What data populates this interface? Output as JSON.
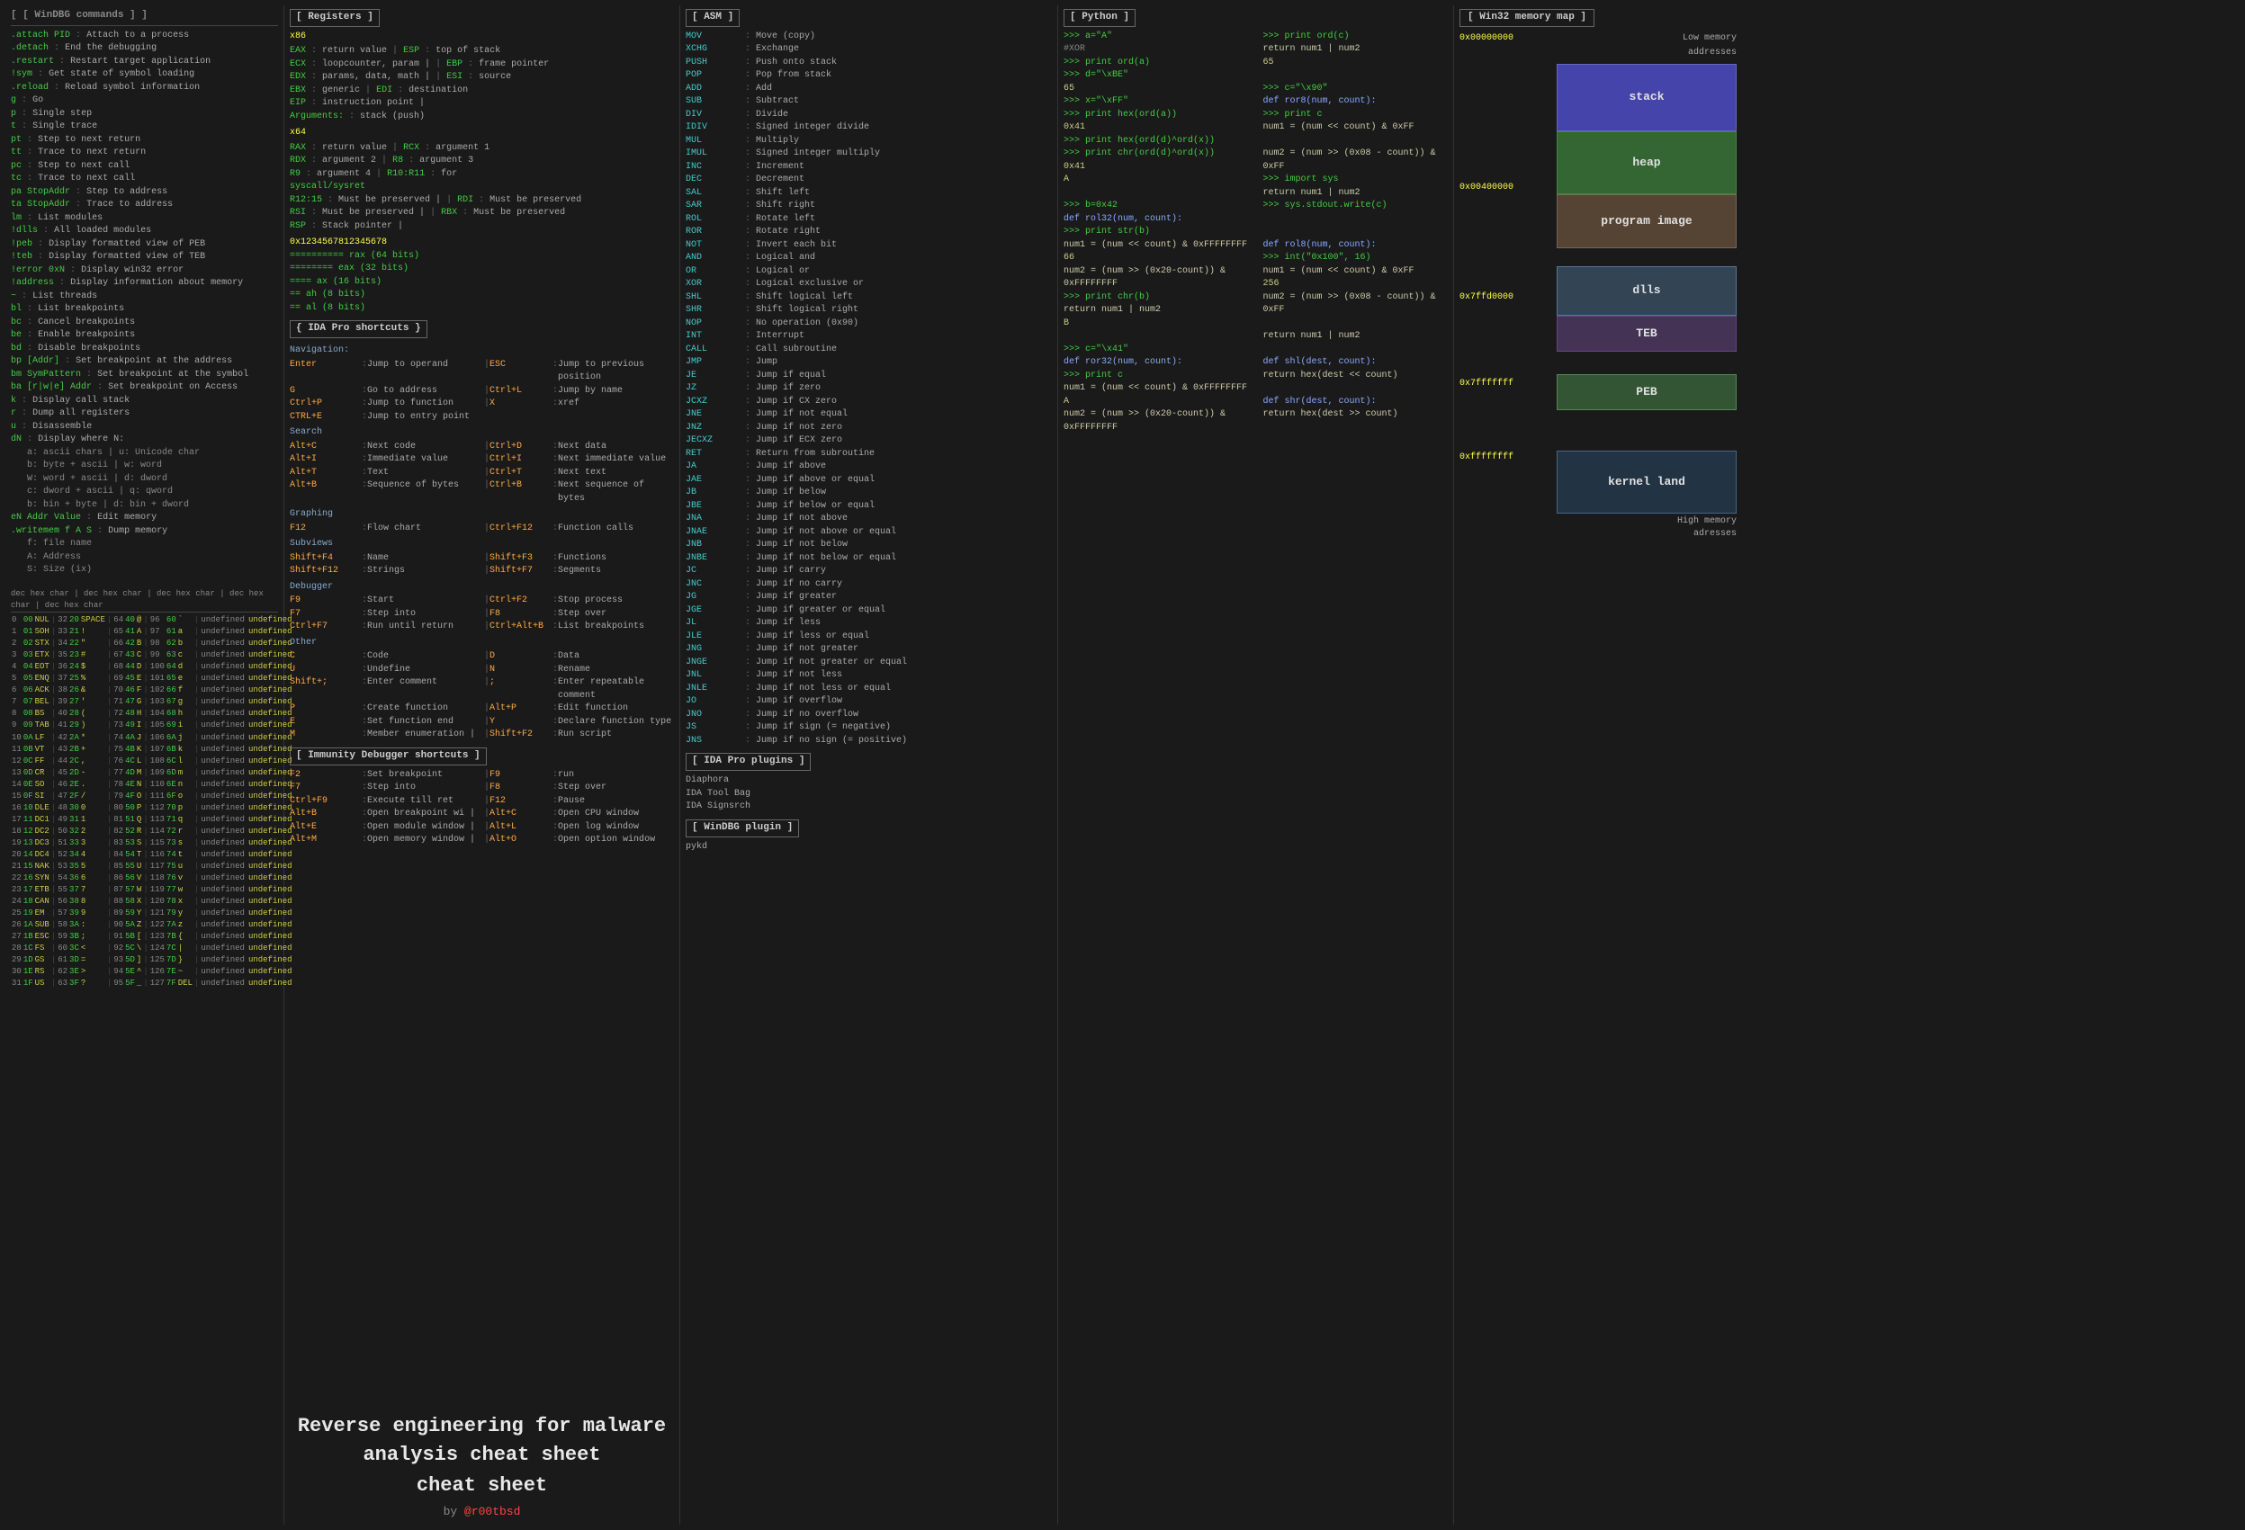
{
  "title": "Reverse engineering for malware analysis cheat sheet",
  "author": "@r00tbsd",
  "col1": {
    "header": "[ WinDBG commands ]",
    "commands": [
      [
        ".attach PID",
        "Attach to a process"
      ],
      [
        ".detach",
        "End the debugging"
      ],
      [
        ".restart",
        "Restart target application"
      ],
      [
        "!sym",
        "Get state of symbol loading"
      ],
      [
        ".reload",
        "Reload symbol information"
      ],
      [
        "g",
        "Go"
      ],
      [
        "p",
        "Single step"
      ],
      [
        "t",
        "Single trace"
      ],
      [
        "pt",
        "Step to next return"
      ],
      [
        "tt",
        "Trace to next return"
      ],
      [
        "pc",
        "Step to next call"
      ],
      [
        "tc",
        "Trace to next call"
      ],
      [
        "pa StopAddr",
        "Step to address"
      ],
      [
        "ta StopAddr",
        "Trace to address"
      ],
      [
        "lm",
        "List modules"
      ],
      [
        "!dlls",
        "All loaded modules"
      ],
      [
        "!peb",
        "Display formatted view of PEB"
      ],
      [
        "!teb",
        "Display formatted view of TEB"
      ],
      [
        "!error 0xN",
        "Display win32 error"
      ],
      [
        "!address",
        "Display information about memory"
      ],
      [
        "~",
        "List threads"
      ],
      [
        "bl",
        "List breakpoints"
      ],
      [
        "bc",
        "Cancel breakpoints"
      ],
      [
        "be",
        "Enable breakpoints"
      ],
      [
        "bd",
        "Disable breakpoints"
      ],
      [
        "bp [Addr]",
        "Set breakpoint at the address"
      ],
      [
        "bm SymPattern",
        "Set breakpoint at the symbol"
      ],
      [
        "ba [r|w|e] Addr",
        "Set breakpoint on Access"
      ],
      [
        "k",
        "Display call stack"
      ],
      [
        "r",
        "Dump all registers"
      ],
      [
        "u",
        "Disassemble"
      ],
      [
        "dN",
        "Display where N:"
      ],
      [
        "  a: ascii chars | u: Unicode char",
        ""
      ],
      [
        "  b: byte + ascii | w: word",
        ""
      ],
      [
        "  W: word + ascii | d: dword",
        ""
      ],
      [
        "  c: dword + ascii | q: qword",
        ""
      ],
      [
        "  b: bin + byte | d: bin + dword",
        ""
      ],
      [
        "eN Addr Value",
        "Edit memory"
      ],
      [
        ".writemem f A S",
        "Dump memory"
      ],
      [
        "  f: file name",
        ""
      ],
      [
        "  A: Address",
        ""
      ],
      [
        "  S: Size (ix)",
        ""
      ]
    ]
  },
  "col2": {
    "registers_header": "[ Registers ]",
    "x86_label": "x86",
    "registers_x86": [
      [
        "EAX",
        "return value",
        "ESP",
        "top of stack"
      ],
      [
        "ECX",
        "loopcounter, param |",
        "EBP",
        "frame pointer"
      ],
      [
        "EDX",
        "params, data, math |",
        "ESI",
        "source"
      ],
      [
        "EBX",
        "generic",
        "EDI",
        "destination"
      ],
      [
        "EIP",
        "instruction point |",
        "",
        ""
      ],
      [
        "Arguments:",
        "stack (push)",
        "",
        ""
      ]
    ],
    "x64_label": "x64",
    "registers_x64": [
      [
        "RAX",
        "return value",
        "RCX",
        "argument 1"
      ],
      [
        "RDX",
        "argument 2",
        "R8",
        "argument 3"
      ],
      [
        "R9",
        "argument 4",
        "R10:R11",
        "for"
      ],
      [
        "syscall/sysret",
        "",
        "",
        ""
      ],
      [
        "R12:15",
        "Must be preserved |",
        "RDI",
        "Must be preserved"
      ],
      [
        "RSI",
        "Must be preserved |",
        "RBX",
        "Must be preserved"
      ],
      [
        "RSP",
        "Stack pointer |",
        "",
        ""
      ]
    ],
    "hex_value": "0x1234567812345678",
    "hex_breakdown": [
      "========== rax (64 bits)",
      "======== eax (32 bits)",
      "==== ax (16 bits)",
      "== ah (8 bits)",
      "== al (8 bits)"
    ],
    "ida_header": "{ IDA Pro shortcuts }",
    "nav_header": "Navigation:",
    "nav_items": [
      [
        "Enter",
        "Jump to operand",
        "ESC",
        "Jump to previous position"
      ],
      [
        "G",
        "Go to address",
        "Ctrl+L",
        "Jump by name"
      ],
      [
        "Ctrl+P",
        "Jump to function",
        "X",
        "xref"
      ],
      [
        "CTRL+E",
        "Jump to entry point",
        "",
        ""
      ]
    ],
    "search_header": "Search",
    "search_items": [
      [
        "Alt+C",
        "Next code",
        "Ctrl+D",
        "Next data"
      ],
      [
        "Alt+I",
        "Immediate value",
        "Ctrl+I",
        "Next immediate value"
      ],
      [
        "Alt+T",
        "Text",
        "Ctrl+T",
        "Next text"
      ],
      [
        "Alt+B",
        "Sequence of bytes",
        "Ctrl+B",
        "Next sequence of bytes"
      ]
    ],
    "graphing_header": "Graphing",
    "graphing_items": [
      [
        "F12",
        "Flow chart",
        "Ctrl+F12",
        "Function calls"
      ]
    ],
    "subviews_header": "Subviews",
    "subviews_items": [
      [
        "Shift+F4",
        "Name",
        "Shift+F3",
        "Functions"
      ],
      [
        "Shift+F12",
        "Strings",
        "Shift+F7",
        "Segments"
      ]
    ],
    "debugger_header": "Debugger",
    "debugger_items": [
      [
        "F9",
        "Start",
        "Ctrl+F2",
        "Stop process"
      ],
      [
        "F7",
        "Step into",
        "F8",
        "Step over"
      ],
      [
        "Ctrl+F7",
        "Run until return",
        "Ctrl+Alt+B",
        "List breakpoints"
      ]
    ],
    "other_header": "Other",
    "other_items": [
      [
        "C",
        "Code",
        "D",
        "Data"
      ],
      [
        "U",
        "Undefine",
        "N",
        "Rename"
      ],
      [
        "Shift+;",
        "Enter comment",
        ";",
        "Enter repeatable comment"
      ],
      [
        "P",
        "Create function",
        "Alt+P",
        "Edit function"
      ],
      [
        "E",
        "Set function end",
        "Y",
        "Declare function type"
      ],
      [
        "M",
        "Member enumeration |",
        "Shift+F2",
        "Run script"
      ]
    ],
    "immunity_header": "[ Immunity Debugger shortcuts ]",
    "immunity_items": [
      [
        "F2",
        "Set breakpoint",
        "F9",
        "run"
      ],
      [
        "F7",
        "Step into",
        "F8",
        "Step over"
      ],
      [
        "Ctrl+F9",
        "Execute till ret",
        "F12",
        "Pause"
      ],
      [
        "Alt+B",
        "Open breakpoint wi |",
        "Alt+C",
        "Open CPU window"
      ],
      [
        "Alt+E",
        "Open module window |",
        "Alt+L",
        "Open log window"
      ],
      [
        "Alt+M",
        "Open memory window |",
        "Alt+O",
        "Open option window"
      ]
    ]
  },
  "col3": {
    "asm_header": "[ ASM ]",
    "asm_items": [
      [
        "MOV",
        "Move (copy)"
      ],
      [
        "XCHG",
        "Exchange"
      ],
      [
        "PUSH",
        "Push onto stack"
      ],
      [
        "POP",
        "Pop from stack"
      ],
      [
        "ADD",
        "Add"
      ],
      [
        "SUB",
        "Subtract"
      ],
      [
        "DIV",
        "Divide"
      ],
      [
        "IDIV",
        "Signed integer divide"
      ],
      [
        "MUL",
        "Multiply"
      ],
      [
        "IMUL",
        "Signed integer multiply"
      ],
      [
        "INC",
        "Increment"
      ],
      [
        "DEC",
        "Decrement"
      ],
      [
        "SAL",
        "Shift left"
      ],
      [
        "SAR",
        "Shift right"
      ],
      [
        "ROL",
        "Rotate left"
      ],
      [
        "ROR",
        "Rotate right"
      ],
      [
        "NOT",
        "Invert each bit"
      ],
      [
        "AND",
        "Logical and"
      ],
      [
        "OR",
        "Logical or"
      ],
      [
        "XOR",
        "Logical exclusive or"
      ],
      [
        "SHL",
        "Shift logical left"
      ],
      [
        "SHR",
        "Shift logical right"
      ],
      [
        "NOP",
        "No operation (0x90)"
      ],
      [
        "INT",
        "Interrupt"
      ],
      [
        "CALL",
        "Call subroutine"
      ],
      [
        "JMP",
        "Jump"
      ],
      [
        "JE",
        "Jump if equal"
      ],
      [
        "JZ",
        "Jump if zero"
      ],
      [
        "JCXZ",
        "Jump if CX zero"
      ],
      [
        "JNE",
        "Jump if not equal"
      ],
      [
        "JNZ",
        "Jump if not zero"
      ],
      [
        "JECXZ",
        "Jump if ECX zero"
      ],
      [
        "RET",
        "Return from subroutine"
      ],
      [
        "JA",
        "Jump if above"
      ],
      [
        "JAE",
        "Jump if above or equal"
      ],
      [
        "JB",
        "Jump if below"
      ],
      [
        "JBE",
        "Jump if below or equal"
      ],
      [
        "JNA",
        "Jump if not above"
      ],
      [
        "JNAE",
        "Jump if not above or equal"
      ],
      [
        "JNB",
        "Jump if not below"
      ],
      [
        "JNBE",
        "Jump if not below or equal"
      ],
      [
        "JC",
        "Jump if carry"
      ],
      [
        "JNC",
        "Jump if no carry"
      ],
      [
        "JG",
        "Jump if greater"
      ],
      [
        "JGE",
        "Jump if greater or equal"
      ],
      [
        "JL",
        "Jump if less"
      ],
      [
        "JLE",
        "Jump if less or equal"
      ],
      [
        "JNG",
        "Jump if not greater"
      ],
      [
        "JNGE",
        "Jump if not greater or equal"
      ],
      [
        "JNL",
        "Jump if not less"
      ],
      [
        "JNLE",
        "Jump if not less or equal"
      ],
      [
        "JO",
        "Jump if overflow"
      ],
      [
        "JNO",
        "Jump if no overflow"
      ],
      [
        "JS",
        "Jump if sign (= negative)"
      ],
      [
        "JNS",
        "Jump if no sign (= positive)"
      ]
    ],
    "ida_plugins_header": "[ IDA Pro plugins ]",
    "plugins": [
      "Diaphora",
      "IDA Tool Bag",
      "IDA Signsrch"
    ],
    "windbg_plugin_header": "[ WinDBG plugin ]",
    "windbg_plugins": [
      "pykd"
    ]
  },
  "col4": {
    "python_header": "[ Python ]",
    "python_items": [
      ">>> a=\"A\"",
      "#XOR",
      ">>> print ord(a)",
      ">>> d=\"\\xBE\"",
      "65",
      ">>> x=\"\\xFF\"",
      ">>> print hex(ord(a))",
      "0x41",
      ">>> print hex(ord(d)^ord(x))",
      ">>> print chr(ord(d)^ord(x))",
      "0x41",
      "A",
      "",
      ">>> b=0x42",
      "def rol32(num, count):",
      ">>> print str(b)",
      "  num1 = (num << count) & 0xFFFFFFFF",
      "66",
      "  num2 = (num >> (0x20-count)) & 0xFFFFFFFF",
      ">>> print chr(b)",
      "  return num1 | num2",
      "B",
      "",
      ">>> c=\"\\x41\"",
      "def ror32(num, count):",
      ">>> print c",
      "  num1 = (num << count) & 0xFFFFFFFF",
      "A",
      "  num2 = (num >> (0x20-count)) & 0xFFFFFFFF",
      ">>> print ord(c)",
      "  return num1 | num2",
      "65",
      "",
      ">>> c=\"\\x90\"",
      "def ror8(num, count):",
      ">>> print c",
      "  num1 = (num << count) & 0xFF",
      "",
      "  num2 = (num >> (0x08 - count)) & 0xFF",
      ">>> import sys",
      "  return num1 | num2",
      ">>> sys.stdout.write(c)",
      "",
      "",
      "def rol8(num, count):",
      ">>> int(\"0x100\", 16)",
      "  num1 = (num << count) & 0xFF",
      "256",
      "  num2 = (num >> (0x08 - count)) & 0xFF",
      "",
      "  return num1 | num2",
      "",
      "def shl(dest, count):",
      "  return hex(dest << count)",
      "",
      "def shr(dest, count):",
      "  return hex(dest >> count)"
    ]
  },
  "memmap": {
    "header": "[ Win32 memory map ]",
    "low_memory": "Low memory",
    "addresses": "addresses",
    "high_memory": "High memory",
    "adresses2": "adresses",
    "segments": [
      {
        "label": "stack",
        "class": "seg-stack",
        "addr_before": "0x00000000"
      },
      {
        "label": "heap",
        "class": "seg-heap"
      },
      {
        "label": "program image",
        "class": "seg-program",
        "addr_after": "0x00400000"
      },
      {
        "label": "",
        "class": "seg-space1"
      },
      {
        "label": "dlls",
        "class": "seg-dlls"
      },
      {
        "label": "TEB",
        "class": "seg-teb"
      },
      {
        "label": "",
        "class": "seg-space2",
        "addr_after": "0x7ffd0000"
      },
      {
        "label": "PEB",
        "class": "seg-peb"
      },
      {
        "label": "",
        "class": "seg-space3",
        "addr_after": "0x7fffffff"
      },
      {
        "label": "kernel land",
        "class": "seg-kernel",
        "addr_after": "0xffffffff"
      }
    ]
  },
  "hex_table": {
    "header": "dec hex char | dec hex char | dec hex char | dec hex char | dec hex char",
    "rows": [
      [
        0,
        "00",
        "NUL",
        32,
        "20",
        "SPACE",
        64,
        "40",
        "@",
        96,
        "60",
        "`"
      ],
      [
        1,
        "01",
        "SOH",
        33,
        "21",
        "!",
        65,
        "41",
        "A",
        97,
        "61",
        "a"
      ],
      [
        2,
        "02",
        "STX",
        34,
        "22",
        "\"",
        66,
        "42",
        "B",
        98,
        "62",
        "b"
      ],
      [
        3,
        "03",
        "ETX",
        35,
        "23",
        "#",
        67,
        "43",
        "C",
        99,
        "63",
        "c"
      ],
      [
        4,
        "04",
        "EOT",
        36,
        "24",
        "$",
        68,
        "44",
        "D",
        100,
        "64",
        "d"
      ],
      [
        5,
        "05",
        "ENQ",
        37,
        "25",
        "%",
        69,
        "45",
        "E",
        101,
        "65",
        "e"
      ],
      [
        6,
        "06",
        "ACK",
        38,
        "26",
        "&",
        70,
        "46",
        "F",
        102,
        "66",
        "f"
      ],
      [
        7,
        "07",
        "BEL",
        39,
        "27",
        "'",
        71,
        "47",
        "G",
        103,
        "67",
        "g"
      ],
      [
        8,
        "08",
        "BS",
        40,
        "28",
        "(",
        72,
        "48",
        "H",
        104,
        "68",
        "h"
      ],
      [
        9,
        "09",
        "TAB",
        41,
        "29",
        ")",
        73,
        "49",
        "I",
        105,
        "69",
        "i"
      ],
      [
        10,
        "0A",
        "LF",
        42,
        "2A",
        "*",
        74,
        "4A",
        "J",
        106,
        "6A",
        "j"
      ],
      [
        11,
        "0B",
        "VT",
        43,
        "2B",
        "+",
        75,
        "4B",
        "K",
        107,
        "6B",
        "k"
      ],
      [
        12,
        "0C",
        "FF",
        44,
        "2C",
        ",",
        76,
        "4C",
        "L",
        108,
        "6C",
        "l"
      ],
      [
        13,
        "0D",
        "CR",
        45,
        "2D",
        "-",
        77,
        "4D",
        "M",
        109,
        "6D",
        "m"
      ],
      [
        14,
        "0E",
        "SO",
        46,
        "2E",
        ".",
        78,
        "4E",
        "N",
        110,
        "6E",
        "n"
      ],
      [
        15,
        "0F",
        "SI",
        47,
        "2F",
        "/",
        79,
        "4F",
        "O",
        111,
        "6F",
        "o"
      ],
      [
        16,
        "10",
        "DLE",
        48,
        "30",
        "0",
        80,
        "50",
        "P",
        112,
        "70",
        "p"
      ],
      [
        17,
        "11",
        "DC1",
        49,
        "31",
        "1",
        81,
        "51",
        "Q",
        113,
        "71",
        "q"
      ],
      [
        18,
        "12",
        "DC2",
        50,
        "32",
        "2",
        82,
        "52",
        "R",
        114,
        "72",
        "r"
      ],
      [
        19,
        "13",
        "DC3",
        51,
        "33",
        "3",
        83,
        "53",
        "S",
        115,
        "73",
        "s"
      ],
      [
        20,
        "14",
        "DC4",
        52,
        "34",
        "4",
        84,
        "54",
        "T",
        116,
        "74",
        "t"
      ],
      [
        21,
        "15",
        "NAK",
        53,
        "35",
        "5",
        85,
        "55",
        "U",
        117,
        "75",
        "u"
      ],
      [
        22,
        "16",
        "SYN",
        54,
        "36",
        "6",
        86,
        "56",
        "V",
        118,
        "76",
        "v"
      ],
      [
        23,
        "17",
        "ETB",
        55,
        "37",
        "7",
        87,
        "57",
        "W",
        119,
        "77",
        "w"
      ],
      [
        24,
        "18",
        "CAN",
        56,
        "38",
        "8",
        88,
        "58",
        "X",
        120,
        "78",
        "x"
      ],
      [
        25,
        "19",
        "EM",
        57,
        "39",
        "9",
        89,
        "59",
        "Y",
        121,
        "79",
        "y"
      ],
      [
        26,
        "1A",
        "SUB",
        58,
        "3A",
        ":",
        90,
        "5A",
        "Z",
        122,
        "7A",
        "z"
      ],
      [
        27,
        "1B",
        "ESC",
        59,
        "3B",
        ";",
        91,
        "5B",
        "[",
        123,
        "7B",
        "{"
      ],
      [
        28,
        "1C",
        "FS",
        60,
        "3C",
        "<",
        92,
        "5C",
        "\\",
        124,
        "7C",
        "|"
      ],
      [
        29,
        "1D",
        "GS",
        61,
        "3D",
        "=",
        93,
        "5D",
        "]",
        125,
        "7D",
        "}"
      ],
      [
        30,
        "1E",
        "RS",
        62,
        "3E",
        ">",
        94,
        "5E",
        "^",
        126,
        "7E",
        "~"
      ],
      [
        31,
        "1F",
        "US",
        63,
        "3F",
        "?",
        95,
        "5F",
        "_",
        127,
        "7F",
        "DEL"
      ]
    ]
  }
}
